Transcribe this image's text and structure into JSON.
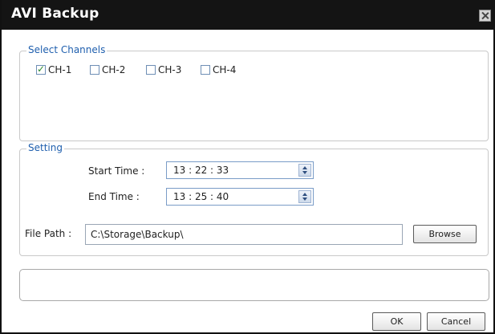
{
  "window": {
    "title": "AVI Backup"
  },
  "channels": {
    "legend": "Select Channels",
    "items": [
      {
        "label": "CH-1",
        "checked": true
      },
      {
        "label": "CH-2",
        "checked": false
      },
      {
        "label": "CH-3",
        "checked": false
      },
      {
        "label": "CH-4",
        "checked": false
      }
    ]
  },
  "setting": {
    "legend": "Setting",
    "start_label": "Start Time :",
    "start_value": "13 : 22 : 33",
    "end_label": "End Time :",
    "end_value": "13 : 25 : 40",
    "path_label": "File Path :",
    "path_value": "C:\\Storage\\Backup\\",
    "browse_label": "Browse"
  },
  "status": {
    "text": ""
  },
  "actions": {
    "ok_label": "OK",
    "cancel_label": "Cancel"
  }
}
